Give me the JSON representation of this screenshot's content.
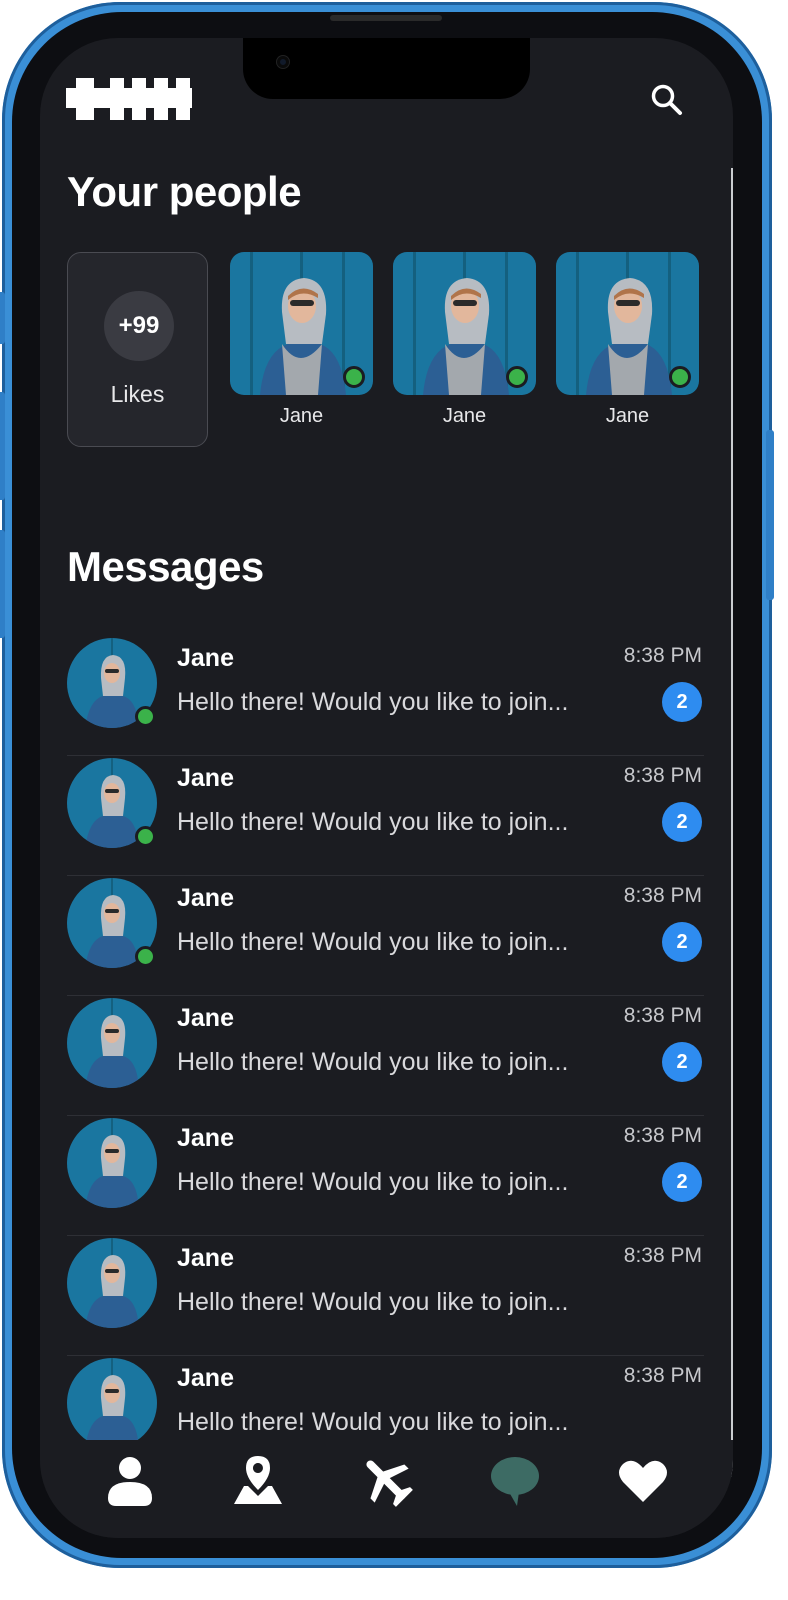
{
  "header": {
    "logo": "logo",
    "search_icon": "search-icon"
  },
  "people_section": {
    "title": "Your people",
    "likes": {
      "count": "+99",
      "label": "Likes"
    },
    "people": [
      {
        "name": "Jane",
        "online": true
      },
      {
        "name": "Jane",
        "online": true
      },
      {
        "name": "Jane",
        "online": true
      }
    ]
  },
  "messages_section": {
    "title": "Messages",
    "items": [
      {
        "name": "Jane",
        "preview": "Hello there! Would you like to join...",
        "time": "8:38 PM",
        "unread": "2",
        "online": true
      },
      {
        "name": "Jane",
        "preview": "Hello there! Would you like to join...",
        "time": "8:38 PM",
        "unread": "2",
        "online": true
      },
      {
        "name": "Jane",
        "preview": "Hello there! Would you like to join...",
        "time": "8:38 PM",
        "unread": "2",
        "online": true
      },
      {
        "name": "Jane",
        "preview": "Hello there! Would you like to join...",
        "time": "8:38 PM",
        "unread": "2",
        "online": false
      },
      {
        "name": "Jane",
        "preview": "Hello there! Would you like to join...",
        "time": "8:38 PM",
        "unread": "2",
        "online": false
      },
      {
        "name": "Jane",
        "preview": "Hello there! Would you like to join...",
        "time": "8:38 PM",
        "unread": "",
        "online": false
      },
      {
        "name": "Jane",
        "preview": "Hello there! Would you like to join...",
        "time": "8:38 PM",
        "unread": "",
        "online": false
      }
    ]
  },
  "bottom_nav": {
    "items": [
      {
        "icon": "profile-icon",
        "active": false
      },
      {
        "icon": "map-pin-icon",
        "active": false
      },
      {
        "icon": "airplane-icon",
        "active": false
      },
      {
        "icon": "chat-bubble-icon",
        "active": true
      },
      {
        "icon": "heart-icon",
        "active": false
      }
    ]
  },
  "colors": {
    "background": "#1b1c21",
    "accent": "#2e8cf0",
    "online": "#3bb24a",
    "active_nav": "#3d6b64",
    "frame": "#3a8fd6"
  }
}
